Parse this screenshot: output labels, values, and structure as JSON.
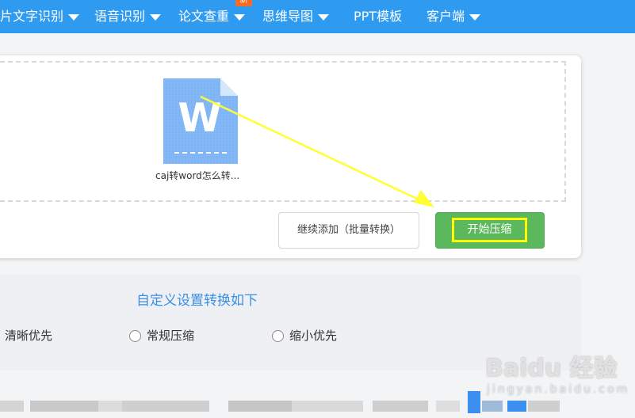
{
  "nav": {
    "items": [
      {
        "label": "片文字识别",
        "has_dropdown": true
      },
      {
        "label": "语音识别",
        "has_dropdown": true
      },
      {
        "label": "论文查重",
        "has_dropdown": true
      },
      {
        "label": "思维导图",
        "has_dropdown": true
      },
      {
        "label": "PPT模板",
        "has_dropdown": false
      },
      {
        "label": "客户端",
        "has_dropdown": true
      }
    ],
    "new_badge": "新"
  },
  "upload": {
    "file_name": "caj转word怎么转...",
    "file_icon_letter": "W",
    "add_button": "继续添加（批量转换）",
    "start_button": "开始压缩"
  },
  "settings": {
    "title": "自定义设置转换如下",
    "options": [
      {
        "label": "清晰优先",
        "selected": false
      },
      {
        "label": "常规压缩",
        "selected": false
      },
      {
        "label": "缩小优先",
        "selected": false
      }
    ]
  },
  "watermark": {
    "main": "Baidu 经验",
    "sub": "jingyan.baidu.com"
  },
  "colors": {
    "nav_bg": "#2f9bf0",
    "start_button": "#5cb85c",
    "highlight": "#ffff00",
    "annotation_arrow": "#ffff33",
    "settings_title": "#3a8ee6",
    "file_icon": "#7fb5f5"
  }
}
